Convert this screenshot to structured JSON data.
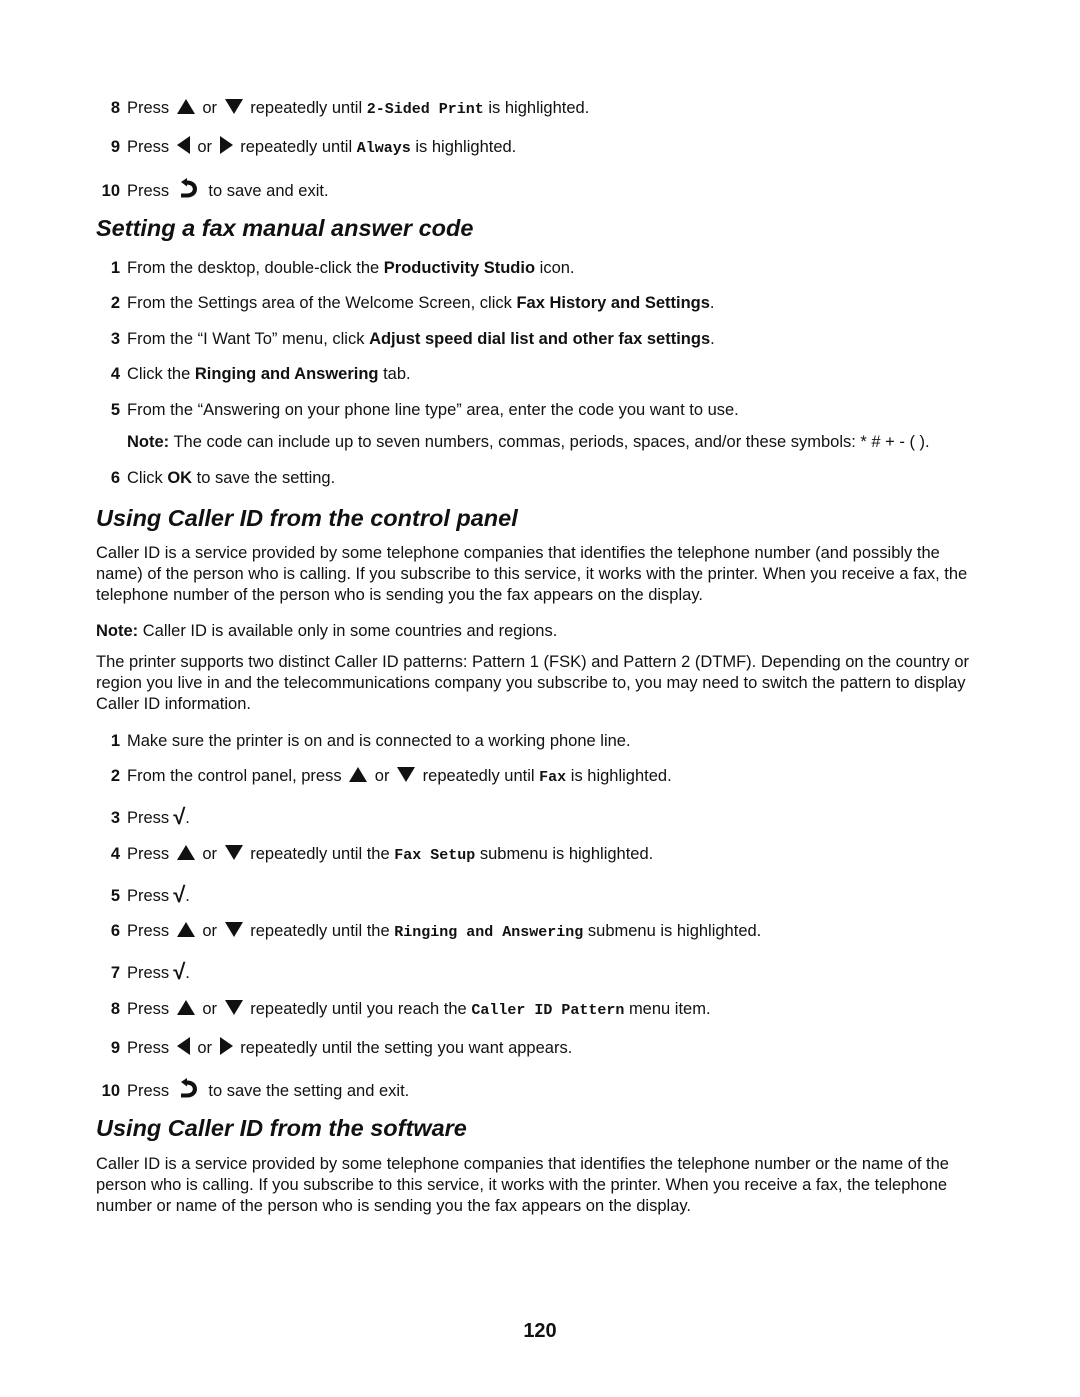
{
  "top_steps": [
    {
      "num": "8",
      "pre": "Press",
      "or": "or",
      "mid": "repeatedly until",
      "code": "2-Sided Print",
      "post": "is highlighted."
    },
    {
      "num": "9",
      "pre": "Press",
      "or": "or",
      "mid": "repeatedly until",
      "code": "Always",
      "post": "is highlighted."
    },
    {
      "num": "10",
      "pre": "Press",
      "post": "to save and exit."
    }
  ],
  "section1": {
    "title": "Setting a fax manual answer code",
    "steps": [
      {
        "num": "1",
        "pre": "From the desktop, double-click the ",
        "bold": "Productivity Studio",
        "post": " icon."
      },
      {
        "num": "2",
        "pre": "From the Settings area of the Welcome Screen, click ",
        "bold": "Fax History and Settings",
        "post": "."
      },
      {
        "num": "3",
        "pre": "From the “I Want To” menu, click ",
        "bold": "Adjust speed dial list and other fax settings",
        "post": "."
      },
      {
        "num": "4",
        "pre": "Click the ",
        "bold": "Ringing and Answering",
        "post": " tab."
      },
      {
        "num": "5",
        "pre": "From the “Answering on your phone line type” area, enter the code you want to use."
      },
      {
        "num": "6",
        "pre": "Click ",
        "bold": "OK",
        "post": " to save the setting."
      }
    ],
    "note_label": "Note:",
    "note_text": " The code can include up to seven numbers, commas, periods, spaces, and/or these symbols: * # + - ( )."
  },
  "section2": {
    "title": "Using Caller ID from the control panel",
    "para1": "Caller ID is a service provided by some telephone companies that identifies the telephone number (and possibly the name) of the person who is calling. If you subscribe to this service, it works with the printer. When you receive a fax, the telephone number of the person who is sending you the fax appears on the display.",
    "note_label": "Note:",
    "note_text": " Caller ID is available only in some countries and regions.",
    "para2": "The printer supports two distinct Caller ID patterns: Pattern 1 (FSK) and Pattern 2 (DTMF). Depending on the country or region you live in and the telecommunications company you subscribe to, you may need to switch the pattern to display Caller ID information.",
    "steps": {
      "s1": {
        "num": "1",
        "text": "Make sure the printer is on and is connected to a working phone line."
      },
      "s2": {
        "num": "2",
        "pre": "From the control panel, press",
        "or": "or",
        "mid": "repeatedly until",
        "code": "Fax",
        "post": "is highlighted."
      },
      "s3": {
        "num": "3",
        "pre": "Press",
        "post": "."
      },
      "s4": {
        "num": "4",
        "pre": "Press",
        "or": "or",
        "mid": "repeatedly until the",
        "code": "Fax Setup",
        "post": "submenu is highlighted."
      },
      "s5": {
        "num": "5",
        "pre": "Press",
        "post": "."
      },
      "s6": {
        "num": "6",
        "pre": "Press",
        "or": "or",
        "mid": "repeatedly until the",
        "code": "Ringing and Answering",
        "post": "submenu is highlighted."
      },
      "s7": {
        "num": "7",
        "pre": "Press",
        "post": "."
      },
      "s8": {
        "num": "8",
        "pre": "Press",
        "or": "or",
        "mid": "repeatedly until you reach the",
        "code": "Caller ID Pattern",
        "post": "menu item."
      },
      "s9": {
        "num": "9",
        "pre": "Press",
        "or": "or",
        "mid": "repeatedly until the setting you want appears."
      },
      "s10": {
        "num": "10",
        "pre": "Press",
        "post": "to save the setting and exit."
      }
    }
  },
  "section3": {
    "title": "Using Caller ID from the software",
    "para1": "Caller ID is a service provided by some telephone companies that identifies the telephone number or the name of the person who is calling. If you subscribe to this service, it works with the printer. When you receive a fax, the telephone number or name of the person who is sending you the fax appears on the display."
  },
  "icons": {
    "up": "up-arrow-button",
    "down": "down-arrow-button",
    "left": "left-arrow-button",
    "right": "right-arrow-button",
    "select": "checkmark-select-button",
    "back": "back-button"
  },
  "check_glyph": "√",
  "page_number": "120"
}
